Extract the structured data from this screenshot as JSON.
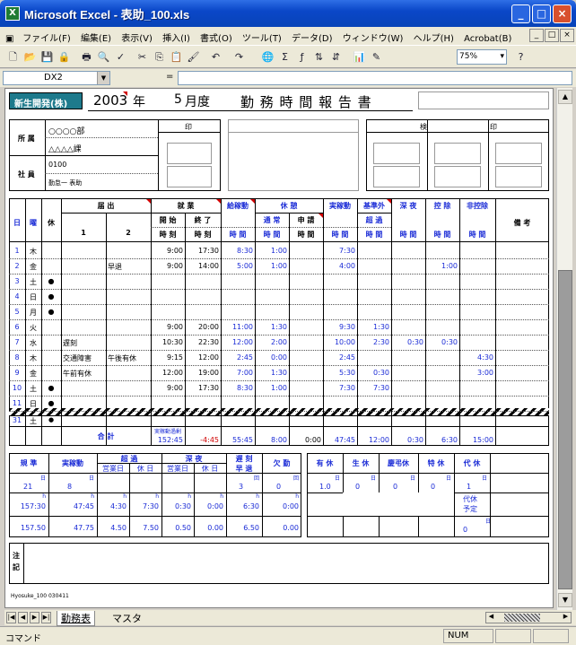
{
  "window": {
    "title": "Microsoft Excel - 表助_100.xls",
    "minimize": "_",
    "maximize": "□",
    "close": "×"
  },
  "menu": [
    "ファイル(F)",
    "編集(E)",
    "表示(V)",
    "挿入(I)",
    "書式(O)",
    "ツール(T)",
    "データ(D)",
    "ウィンドウ(W)",
    "ヘルプ(H)",
    "Acrobat(B)"
  ],
  "mdi_controls": [
    "_",
    "□",
    "×"
  ],
  "zoom": "75%",
  "namebox": "DX2",
  "formula_eq": "=",
  "header": {
    "company": "新生開発(株)",
    "year": "2003",
    "year_unit": "年",
    "month": "5",
    "month_unit": "月度",
    "title": "勤 務 時 間 報 告 書"
  },
  "info": {
    "dept_label": "所 属",
    "dept1": "○○○○部",
    "dept2": "△△△△課",
    "emp_label": "社 員",
    "emp_id": "0100",
    "emp_name": "勤怠一 表助",
    "seal": "印",
    "check": "検",
    "seal2": "印"
  },
  "cols": {
    "day": "日",
    "dow": "曜",
    "holiday": "休",
    "todoke": "届 出",
    "t1": "1",
    "t2": "2",
    "shugyo": "就 業",
    "start": "開 始",
    "start2": "時 刻",
    "end": "終 了",
    "end2": "時 刻",
    "kyuyo": "給稼動",
    "kyuyo2": "時 間",
    "kyukei": "休 憩",
    "tsujo": "通 常",
    "tsujo2": "時 間",
    "shinsei": "申 請",
    "shinsei2": "時 間",
    "jitsu": "実稼動",
    "jitsu2": "時 間",
    "kijun": "基準外",
    "choka": "超 過",
    "choka2": "時 間",
    "shinya": "深 夜",
    "shinya2": "時 間",
    "kojo": "控 除",
    "kojo2": "時 間",
    "hikojo": "非控除",
    "hikojo2": "時 間",
    "biko": "備 考"
  },
  "rows": [
    {
      "d": "1",
      "w": "木",
      "h": "",
      "n1": "",
      "n2": "",
      "s": "9:00",
      "e": "17:30",
      "k": "8:30",
      "r1": "1:00",
      "r2": "",
      "j": "7:30",
      "o": "",
      "sy": "",
      "kj": "",
      "hk": ""
    },
    {
      "d": "2",
      "w": "金",
      "h": "",
      "n1": "",
      "n2": "早退",
      "s": "9:00",
      "e": "14:00",
      "k": "5:00",
      "r1": "1:00",
      "r2": "",
      "j": "4:00",
      "o": "",
      "sy": "",
      "kj": "1:00",
      "hk": ""
    },
    {
      "d": "3",
      "w": "土",
      "h": "●",
      "n1": "",
      "n2": "",
      "s": "",
      "e": "",
      "k": "",
      "r1": "",
      "r2": "",
      "j": "",
      "o": "",
      "sy": "",
      "kj": "",
      "hk": ""
    },
    {
      "d": "4",
      "w": "日",
      "h": "●",
      "n1": "",
      "n2": "",
      "s": "",
      "e": "",
      "k": "",
      "r1": "",
      "r2": "",
      "j": "",
      "o": "",
      "sy": "",
      "kj": "",
      "hk": ""
    },
    {
      "d": "5",
      "w": "月",
      "h": "●",
      "n1": "",
      "n2": "",
      "s": "",
      "e": "",
      "k": "",
      "r1": "",
      "r2": "",
      "j": "",
      "o": "",
      "sy": "",
      "kj": "",
      "hk": ""
    },
    {
      "d": "6",
      "w": "火",
      "h": "",
      "n1": "",
      "n2": "",
      "s": "9:00",
      "e": "20:00",
      "k": "11:00",
      "r1": "1:30",
      "r2": "",
      "j": "9:30",
      "o": "1:30",
      "sy": "",
      "kj": "",
      "hk": ""
    },
    {
      "d": "7",
      "w": "水",
      "h": "",
      "n1": "遅刻",
      "n2": "",
      "s": "10:30",
      "e": "22:30",
      "k": "12:00",
      "r1": "2:00",
      "r2": "",
      "j": "10:00",
      "o": "2:30",
      "sy": "0:30",
      "kj": "0:30",
      "hk": ""
    },
    {
      "d": "8",
      "w": "木",
      "h": "",
      "n1": "交通障害",
      "n2": "午後有休",
      "s": "9:15",
      "e": "12:00",
      "k": "2:45",
      "r1": "0:00",
      "r2": "",
      "j": "2:45",
      "o": "",
      "sy": "",
      "kj": "",
      "hk": "4:30"
    },
    {
      "d": "9",
      "w": "金",
      "h": "",
      "n1": "午前有休",
      "n2": "",
      "s": "12:00",
      "e": "19:00",
      "k": "7:00",
      "r1": "1:30",
      "r2": "",
      "j": "5:30",
      "o": "0:30",
      "sy": "",
      "kj": "",
      "hk": "3:00"
    },
    {
      "d": "10",
      "w": "土",
      "h": "●",
      "n1": "",
      "n2": "",
      "s": "9:00",
      "e": "17:30",
      "k": "8:30",
      "r1": "1:00",
      "r2": "",
      "j": "7:30",
      "o": "7:30",
      "sy": "",
      "kj": "",
      "hk": ""
    },
    {
      "d": "11",
      "w": "日",
      "h": "●",
      "n1": "",
      "n2": "",
      "s": "",
      "e": "",
      "k": "",
      "r1": "",
      "r2": "",
      "j": "",
      "o": "",
      "sy": "",
      "kj": "",
      "hk": ""
    }
  ],
  "last_row": {
    "d": "31",
    "w": "土",
    "h": "●"
  },
  "total": {
    "label": "合  計",
    "sub": "実稼動過剰",
    "a": "152:45",
    "b": "-4:45",
    "k": "55:45",
    "r1": "8:00",
    "r2": "0:00",
    "j": "47:45",
    "o": "12:00",
    "sy": "0:30",
    "kj": "6:30",
    "hk": "15:00"
  },
  "summary": {
    "kijun": "規 準",
    "jitsu": "実稼動",
    "choka": "超 過",
    "eigyo": "営業日",
    "kyujitsu": "休 日",
    "shinya": "深 夜",
    "eigyo2": "営業日",
    "kyujitsu2": "休 日",
    "chikoku": "遅 刻",
    "soutai": "早 退",
    "kekkin": "欠 勤",
    "unit_d": "日",
    "unit_h": "h",
    "unit_kai": "回",
    "v_days": "21",
    "v_days2": "8",
    "v_cnt": "3",
    "v_cnt2": "0",
    "v_h1": [
      "157:30",
      "47:45",
      "4:30",
      "7:30",
      "0:30",
      "0:00",
      "6:30",
      "0:00"
    ],
    "v_h2": [
      "157.50",
      "47.75",
      "4.50",
      "7.50",
      "0.50",
      "0.00",
      "6.50",
      "0.00"
    ],
    "yukyu": "有 休",
    "seikyu": "生 休",
    "keicho": "慶弔休",
    "tokkyu": "特 休",
    "daikyu": "代 休",
    "v_leave": [
      "1.0",
      "0",
      "0",
      "0",
      "1"
    ],
    "daikyu_yotei": "代休",
    "daikyu_yotei2": "予定",
    "v_yotei": "0"
  },
  "note_label": "注\n記",
  "footer_code": "Hyosuke_100  030411",
  "tabs": {
    "t1": "勤務表",
    "t2": "マスタ"
  },
  "status": {
    "left": "コマンド",
    "num": "NUM"
  }
}
